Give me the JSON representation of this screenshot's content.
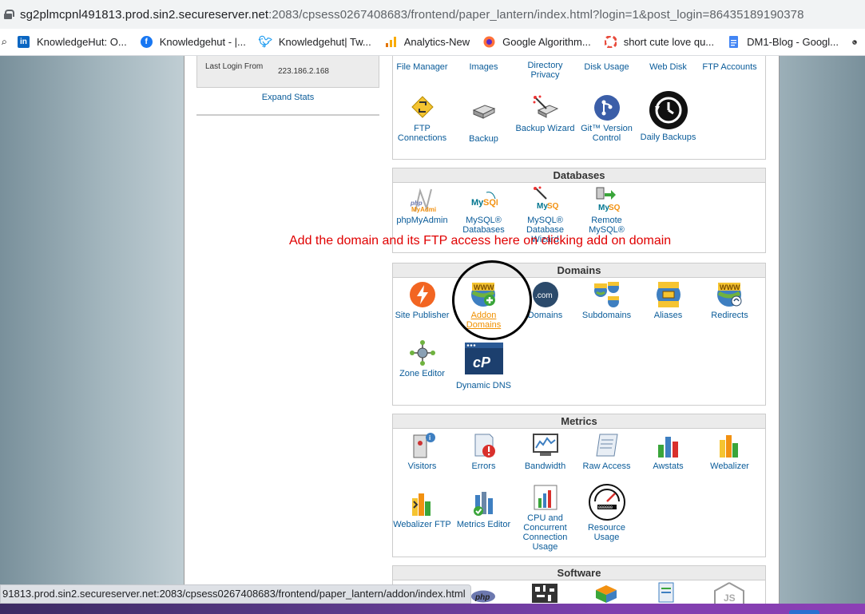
{
  "browser": {
    "url_host": "sg2plmcpnl491813.prod.sin2.secureserver.net",
    "url_rest": ":2083/cpsess0267408683/frontend/paper_lantern/index.html?login=1&post_login=86435189190378",
    "bookmarks": [
      {
        "label": "KnowledgeHut: O...",
        "icon": "linkedin-icon",
        "color": "#0a66c2"
      },
      {
        "label": "Knowledgehut - |...",
        "icon": "facebook-icon",
        "color": "#1877f2"
      },
      {
        "label": "Knowledgehut| Tw...",
        "icon": "twitter-icon",
        "color": "#1d9bf0"
      },
      {
        "label": "Analytics-New",
        "icon": "analytics-icon",
        "color": "#f9ab00"
      },
      {
        "label": "Google Algorithm...",
        "icon": "firefox-icon",
        "color": "#ff7139"
      },
      {
        "label": "short cute love qu...",
        "icon": "pinwheel-icon",
        "color": "#e84c3d"
      },
      {
        "label": "DM1-Blog - Googl...",
        "icon": "google-docs-icon",
        "color": "#4285f4"
      }
    ],
    "status_url": "91813.prod.sin2.secureserver.net:2083/cpsess0267408683/frontend/paper_lantern/addon/index.html"
  },
  "stats": {
    "last_login_label": "Last Login From",
    "last_login_value": "223.186.2.168",
    "expand_label": "Expand Stats"
  },
  "files": {
    "row1": [
      "File Manager",
      "Images",
      "Directory Privacy",
      "Disk Usage",
      "Web Disk",
      "FTP Accounts"
    ],
    "row2": [
      "FTP Connections",
      "Backup",
      "Backup Wizard",
      "Git™ Version Control",
      "Daily Backups"
    ]
  },
  "databases": {
    "title": "Databases",
    "items": [
      "phpMyAdmin",
      "MySQL® Databases",
      "MySQL® Database Wizard",
      "Remote MySQL®"
    ]
  },
  "annotation": "Add the domain and its FTP access here on clicking add on domain",
  "domains": {
    "title": "Domains",
    "items": [
      "Site Publisher",
      "Addon Domains",
      "Domains",
      "Subdomains",
      "Aliases",
      "Redirects",
      "Zone Editor",
      "Dynamic DNS"
    ]
  },
  "metrics": {
    "title": "Metrics",
    "items": [
      "Visitors",
      "Errors",
      "Bandwidth",
      "Raw Access",
      "Awstats",
      "Webalizer",
      "Webalizer FTP",
      "Metrics Editor",
      "CPU and Concurrent Connection Usage",
      "Resource Usage"
    ]
  },
  "software": {
    "title": "Software"
  },
  "colors": {
    "link": "#095b99",
    "hover_link": "#f09000",
    "annotation": "#e00000"
  }
}
